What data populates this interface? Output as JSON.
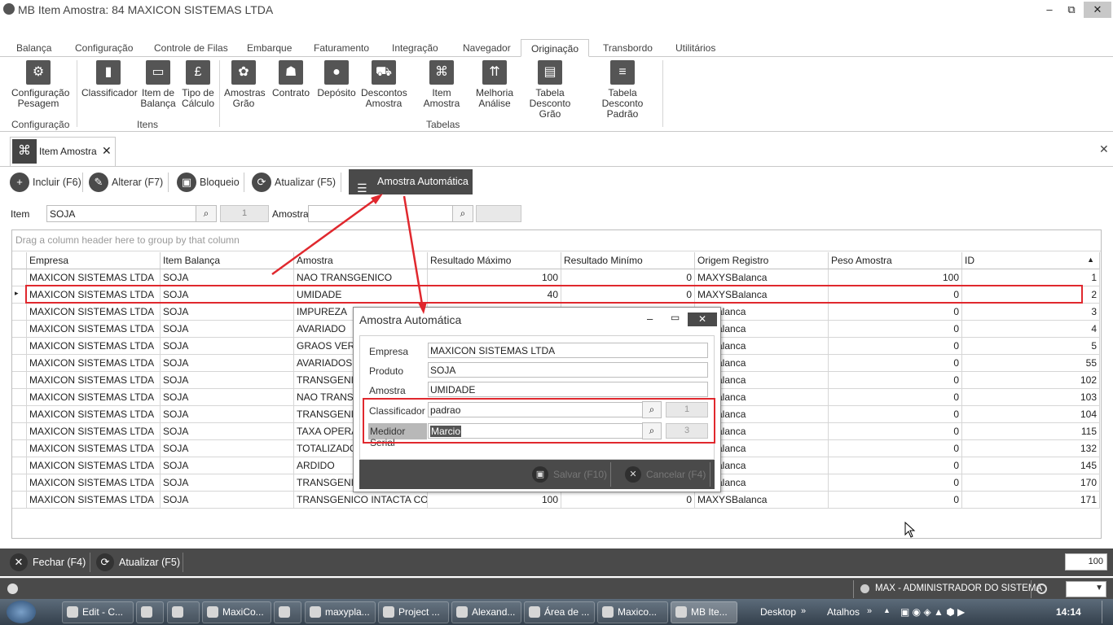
{
  "window": {
    "title": "MB Item Amostra: 84 MAXICON SISTEMAS LTDA",
    "min": "–",
    "max": "⧉",
    "close": "✕"
  },
  "ribbon_tabs": [
    "Balança",
    "Configuração",
    "Controle de Filas",
    "Embarque",
    "Faturamento",
    "Integração",
    "Navegador",
    "Originação",
    "Transbordo",
    "Utilitários"
  ],
  "ribbon_buttons": {
    "config_pesagem": "Configuração\nPesagem",
    "classificador": "Classificador",
    "item_balanca": "Item de\nBalança",
    "tipo_calculo": "Tipo de\nCálculo",
    "amostras_grao": "Amostras\nGrão",
    "contrato": "Contrato",
    "deposito": "Depósito",
    "descontos_amostra": "Descontos\nAmostra",
    "item_amostra": "Item Amostra",
    "melhoria_analise": "Melhoria\nAnálise",
    "tabela_desconto_grao": "Tabela\nDesconto Grão",
    "tabela_desconto_padrao": "Tabela Desconto\nPadrão"
  },
  "ribbon_groups": {
    "configuracao": "Configuração",
    "itens": "Itens",
    "tabelas": "Tabelas"
  },
  "doc_tab": {
    "label": "Item Amostra",
    "close": "✕",
    "panel_close": "✕"
  },
  "toolbar": {
    "incluir": "Incluir (F6)",
    "alterar": "Alterar (F7)",
    "bloqueio": "Bloqueio",
    "atualizar": "Atualizar (F5)",
    "amostra_auto": "Amostra Automática"
  },
  "filter": {
    "item_label": "Item",
    "item_value": "SOJA",
    "item_code": "1",
    "amostra_label": "Amostra",
    "amostra_value": "",
    "amostra_code": ""
  },
  "grid": {
    "group_hint": "Drag a column header here to group by that column",
    "columns": [
      "Empresa",
      "Item Balança",
      "Amostra",
      "Resultado Máximo",
      "Resultado Minímo",
      "Origem Registro",
      "Peso Amostra",
      "ID"
    ],
    "rows": [
      [
        "MAXICON SISTEMAS LTDA",
        "SOJA",
        "NAO TRANSGENICO",
        "100",
        "0",
        "MAXYSBalanca",
        "100",
        "1"
      ],
      [
        "MAXICON SISTEMAS LTDA",
        "SOJA",
        "UMIDADE",
        "40",
        "0",
        "MAXYSBalanca",
        "0",
        "2"
      ],
      [
        "MAXICON SISTEMAS LTDA",
        "SOJA",
        "IMPUREZA",
        "",
        "",
        "YSBalanca",
        "0",
        "3"
      ],
      [
        "MAXICON SISTEMAS LTDA",
        "SOJA",
        "AVARIADO",
        "",
        "",
        "YSBalanca",
        "0",
        "4"
      ],
      [
        "MAXICON SISTEMAS LTDA",
        "SOJA",
        "GRAOS VERDE",
        "",
        "",
        "YSBalanca",
        "0",
        "5"
      ],
      [
        "MAXICON SISTEMAS LTDA",
        "SOJA",
        "AVARIADOS T",
        "",
        "",
        "YSBalanca",
        "0",
        "55"
      ],
      [
        "MAXICON SISTEMAS LTDA",
        "SOJA",
        "TRANSGENICO",
        "",
        "",
        "YSBalanca",
        "0",
        "102"
      ],
      [
        "MAXICON SISTEMAS LTDA",
        "SOJA",
        "NAO TRANSGE",
        "",
        "",
        "YSBalanca",
        "0",
        "103"
      ],
      [
        "MAXICON SISTEMAS LTDA",
        "SOJA",
        "TRANSGENICO",
        "",
        "",
        "YSBalanca",
        "0",
        "104"
      ],
      [
        "MAXICON SISTEMAS LTDA",
        "SOJA",
        "TAXA OPERAC",
        "",
        "",
        "YSBalanca",
        "0",
        "115"
      ],
      [
        "MAXICON SISTEMAS LTDA",
        "SOJA",
        "TOTALIZADOR",
        "",
        "",
        "YSBalanca",
        "0",
        "132"
      ],
      [
        "MAXICON SISTEMAS LTDA",
        "SOJA",
        "ARDIDO",
        "",
        "",
        "YSBalanca",
        "0",
        "145"
      ],
      [
        "MAXICON SISTEMAS LTDA",
        "SOJA",
        "TRANSGENICO",
        "",
        "",
        "YSBalanca",
        "0",
        "170"
      ],
      [
        "MAXICON SISTEMAS LTDA",
        "SOJA",
        "TRANSGENICO INTACTA COM...",
        "100",
        "0",
        "MAXYSBalanca",
        "0",
        "171"
      ]
    ]
  },
  "dialog": {
    "title": "Amostra Automática",
    "empresa_label": "Empresa",
    "empresa_value": "MAXICON SISTEMAS LTDA",
    "produto_label": "Produto",
    "produto_value": "SOJA",
    "amostra_label": "Amostra",
    "amostra_value": "UMIDADE",
    "classificador_label": "Classificador",
    "classificador_value": "padrao",
    "classificador_code": "1",
    "medidor_label": "Medidor Serial",
    "medidor_value": "Marcio",
    "medidor_code": "3",
    "salvar": "Salvar (F10)",
    "cancelar": "Cancelar (F4)"
  },
  "bottombar": {
    "fechar": "Fechar (F4)",
    "atualizar": "Atualizar (F5)",
    "page_size": "100"
  },
  "status": {
    "user": "MAX - ADMINISTRADOR DO SISTEMA"
  },
  "taskbar": {
    "items": [
      "Edit - C...",
      "",
      "",
      "MaxiCo...",
      "",
      "maxypla...",
      "Project ...",
      "Alexand...",
      "Área de ...",
      "Maxico...",
      "MB Ite..."
    ],
    "desktop": "Desktop",
    "atalhos": "Atalhos",
    "clock": "14:14"
  },
  "colors": {
    "accent_dark": "#4a4a4a",
    "annotation_red": "#e0282e"
  }
}
